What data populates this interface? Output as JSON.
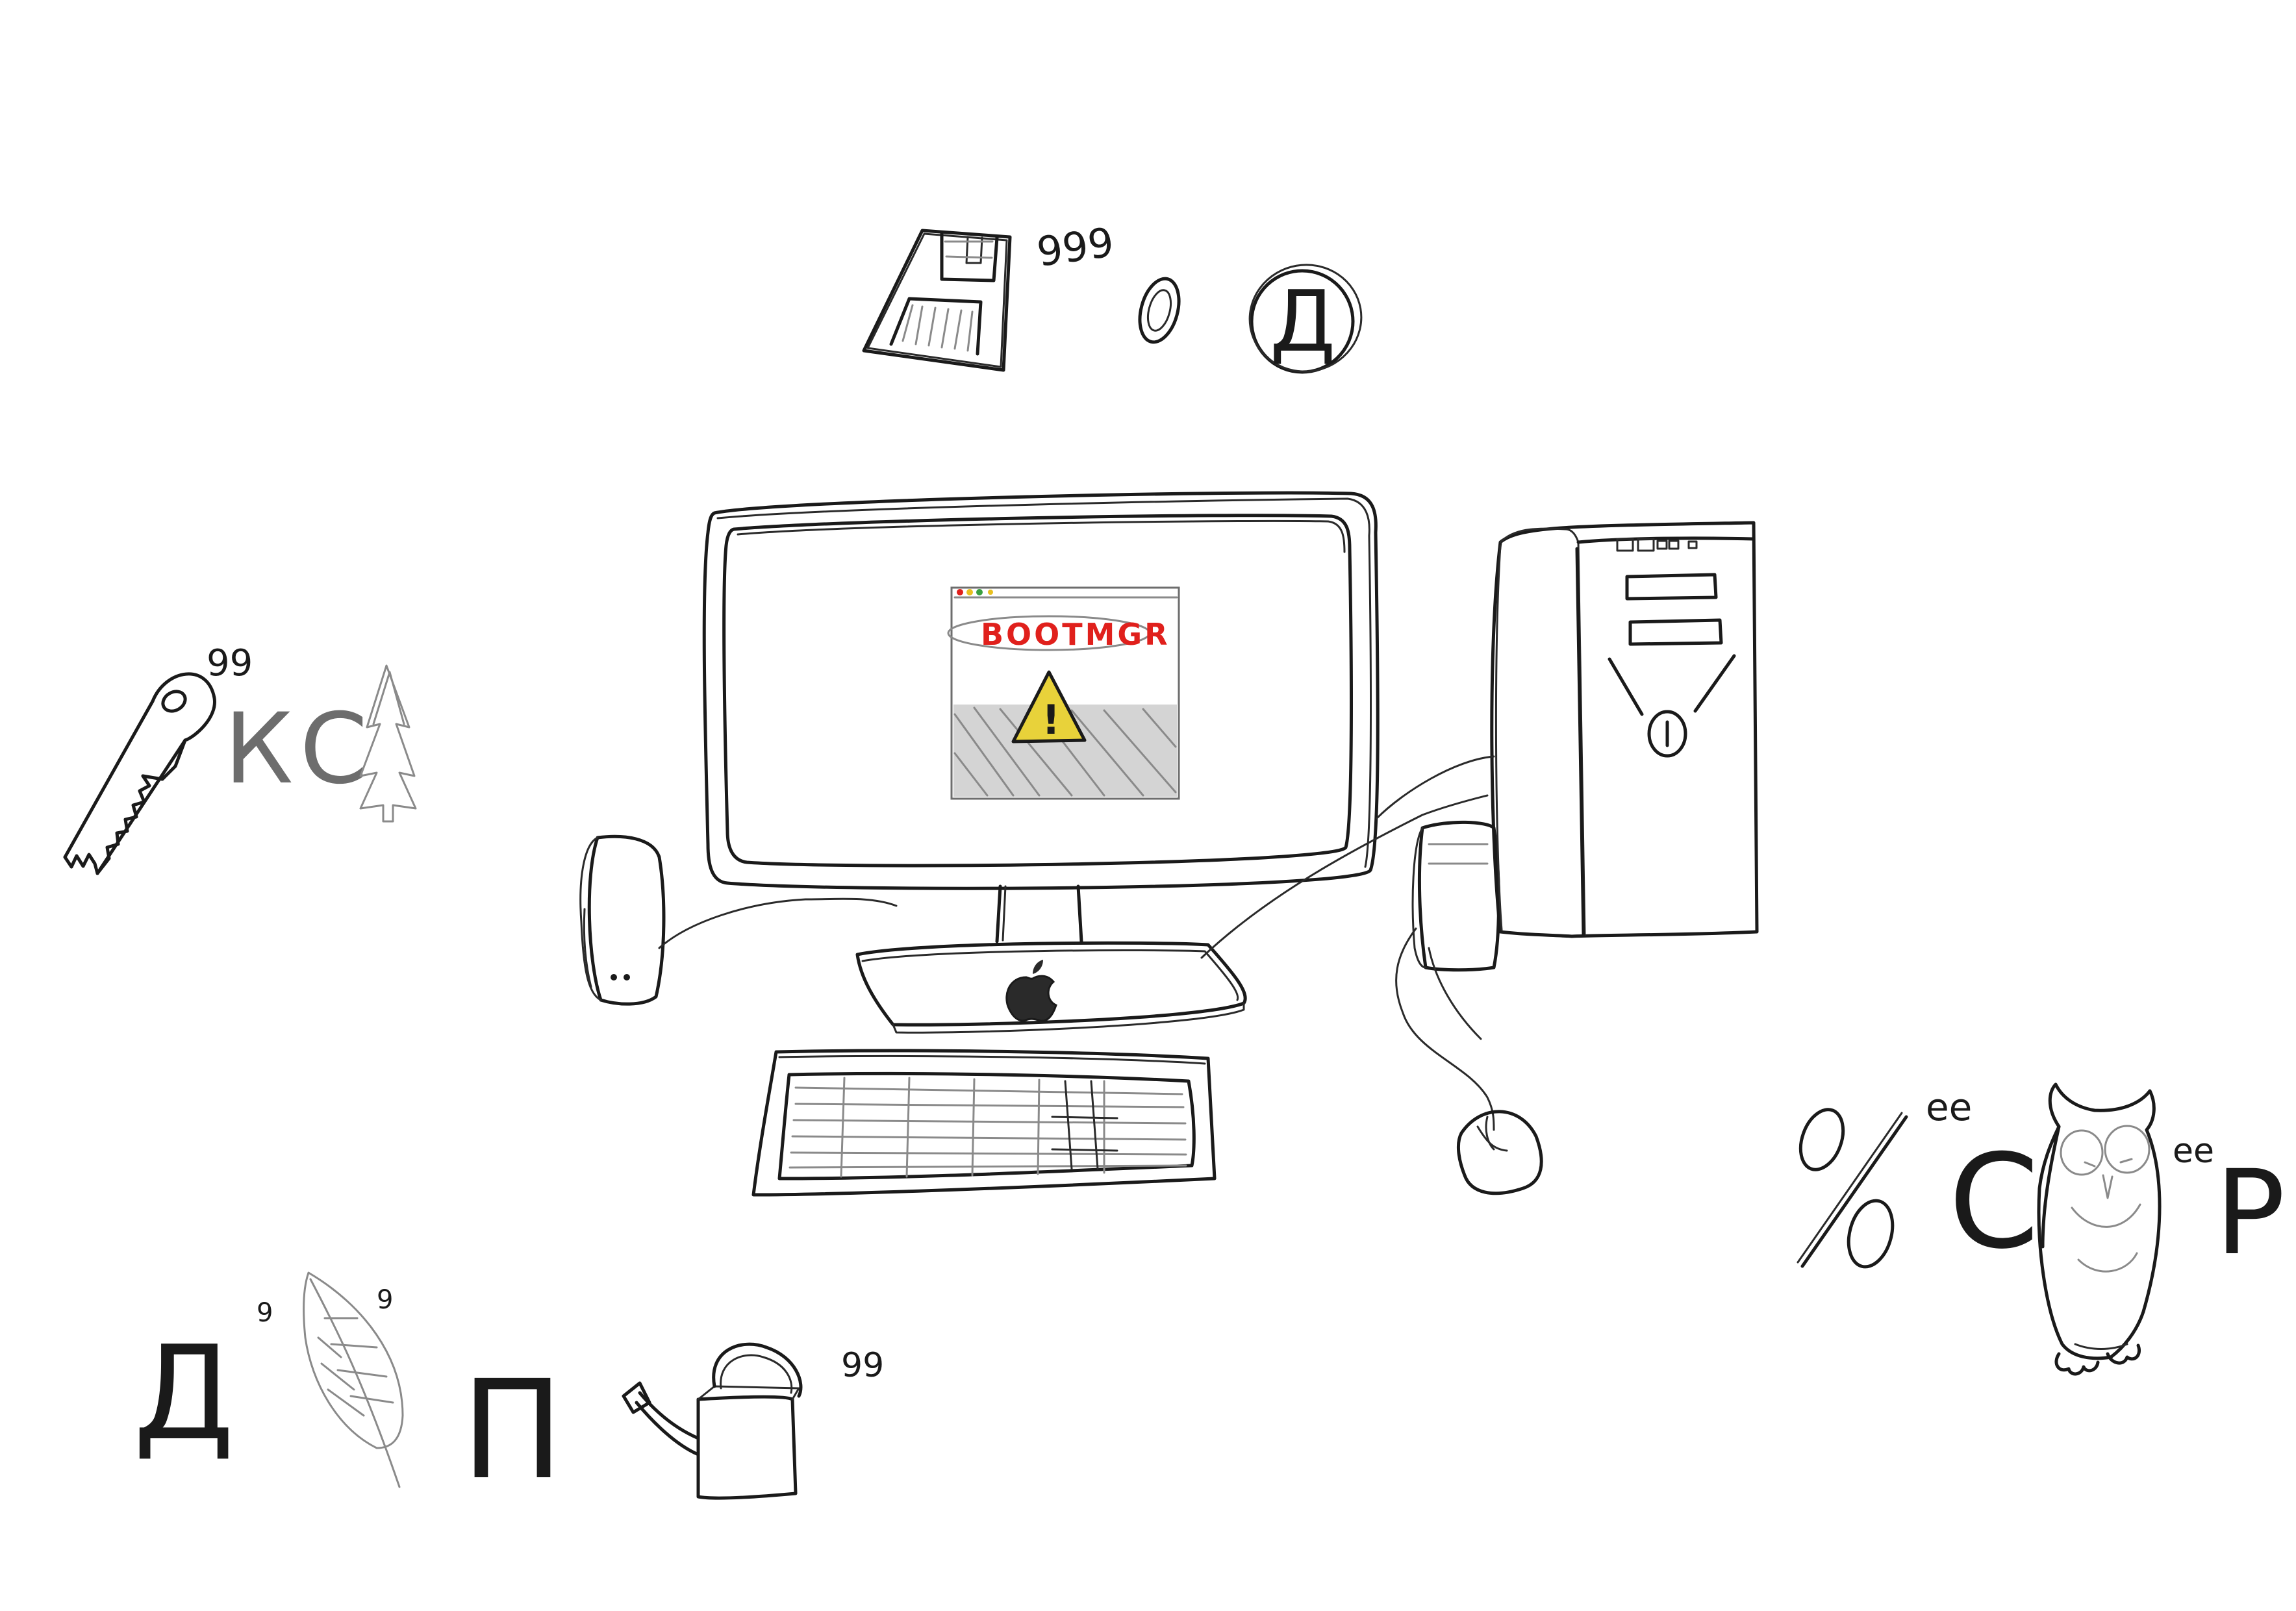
{
  "screen": {
    "error_label": "BOOTMGR",
    "warning_glyph": "!"
  },
  "rebuses": {
    "top": {
      "commas": "999",
      "letter_1": "о",
      "letter_2": "Д"
    },
    "left": {
      "commas": "99",
      "letters": "КС"
    },
    "right": {
      "percent": "%",
      "marks_1": "ee",
      "letter_c": "С",
      "marks_2": "ee",
      "letter_p": "Р"
    },
    "bottom": {
      "letter_d": "Д",
      "comma_1": "9",
      "comma_2": "9",
      "letter_p": "П",
      "commas": "99"
    }
  },
  "icons": {
    "floppy": "floppy-disk-icon",
    "saw": "saw-icon",
    "tree": "fir-tree-icon",
    "owl": "owl-icon",
    "leaf": "leaf-icon",
    "watering_can": "watering-can-icon",
    "apple": "apple-logo-icon",
    "warning": "warning-icon"
  },
  "colors": {
    "ink": "#1a1a1a",
    "pencil": "#8a8a8a",
    "error_red": "#e0201c",
    "warning_yellow": "#e8d23a",
    "dot_red": "#e0201c",
    "dot_yellow": "#e8c020",
    "dot_green": "#3aa040",
    "screen_grey": "#d4d4d4"
  }
}
